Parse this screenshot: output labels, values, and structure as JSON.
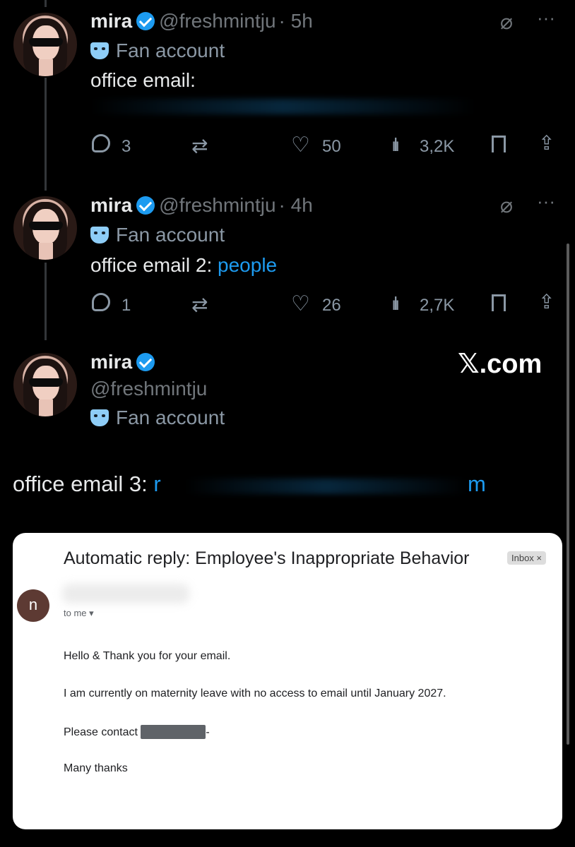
{
  "tweets": [
    {
      "name": "mira",
      "handle": "@freshmintju",
      "time": "· 5h",
      "label": "Fan account",
      "text": "office email:",
      "link_text": "",
      "replies": "3",
      "likes": "50",
      "views": "3,2K"
    },
    {
      "name": "mira",
      "handle": "@freshmintju",
      "time": "· 4h",
      "label": "Fan account",
      "text": "office email 2:",
      "link_text": "people",
      "replies": "1",
      "likes": "26",
      "views": "2,7K"
    }
  ],
  "profile": {
    "name": "mira",
    "handle": "@freshmintju",
    "label": "Fan account",
    "watermark": "𝕏.com"
  },
  "email3": {
    "label": "office email 3:",
    "link_start": "r",
    "link_end": "m"
  },
  "email": {
    "subject": "Automatic reply: Employee's Inappropriate Behavior",
    "badge": "Inbox ×",
    "sender_initial": "n",
    "to": "to me ▾",
    "greeting": "Hello & Thank you for your email.",
    "body": "I am currently on maternity leave with no access to email until January 2027.",
    "contact": "Please contact",
    "contact_sep": "-",
    "closing": "Many thanks"
  },
  "colors": {
    "accent": "#1d9bf0",
    "background": "#000000",
    "muted": "#71767b"
  }
}
